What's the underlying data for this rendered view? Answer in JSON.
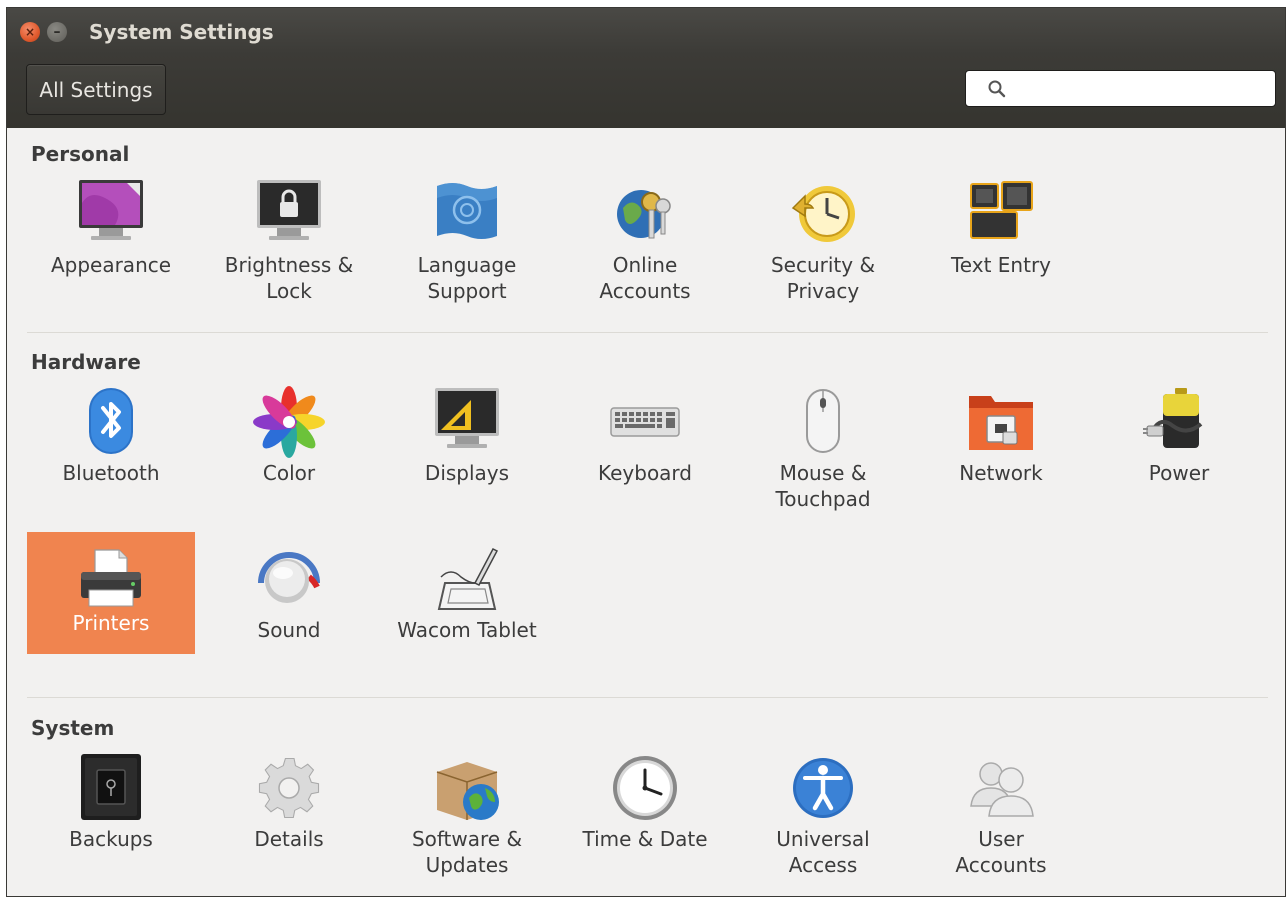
{
  "window": {
    "title": "System Settings"
  },
  "toolbar": {
    "all_settings_label": "All Settings",
    "search_placeholder": "",
    "search_value": ""
  },
  "sections": {
    "personal": {
      "title": "Personal",
      "items": [
        {
          "label": "Appearance",
          "icon": "appearance-icon"
        },
        {
          "label": "Brightness &\nLock",
          "icon": "brightness-lock-icon"
        },
        {
          "label": "Language\nSupport",
          "icon": "language-support-icon"
        },
        {
          "label": "Online\nAccounts",
          "icon": "online-accounts-icon"
        },
        {
          "label": "Security &\nPrivacy",
          "icon": "security-privacy-icon"
        },
        {
          "label": "Text Entry",
          "icon": "text-entry-icon"
        }
      ]
    },
    "hardware": {
      "title": "Hardware",
      "items": [
        {
          "label": "Bluetooth",
          "icon": "bluetooth-icon"
        },
        {
          "label": "Color",
          "icon": "color-icon"
        },
        {
          "label": "Displays",
          "icon": "displays-icon"
        },
        {
          "label": "Keyboard",
          "icon": "keyboard-icon"
        },
        {
          "label": "Mouse &\nTouchpad",
          "icon": "mouse-touchpad-icon"
        },
        {
          "label": "Network",
          "icon": "network-icon"
        },
        {
          "label": "Power",
          "icon": "power-icon"
        },
        {
          "label": "Printers",
          "icon": "printers-icon",
          "selected": true
        },
        {
          "label": "Sound",
          "icon": "sound-icon"
        },
        {
          "label": "Wacom Tablet",
          "icon": "wacom-tablet-icon"
        }
      ]
    },
    "system": {
      "title": "System",
      "items": [
        {
          "label": "Backups",
          "icon": "backups-icon"
        },
        {
          "label": "Details",
          "icon": "details-icon"
        },
        {
          "label": "Software &\nUpdates",
          "icon": "software-updates-icon"
        },
        {
          "label": "Time & Date",
          "icon": "time-date-icon"
        },
        {
          "label": "Universal\nAccess",
          "icon": "universal-access-icon"
        },
        {
          "label": "User\nAccounts",
          "icon": "user-accounts-icon"
        }
      ]
    }
  },
  "colors": {
    "selection": "#f0844f",
    "titlebar": "#3c3b37",
    "background": "#f2f1f0"
  }
}
